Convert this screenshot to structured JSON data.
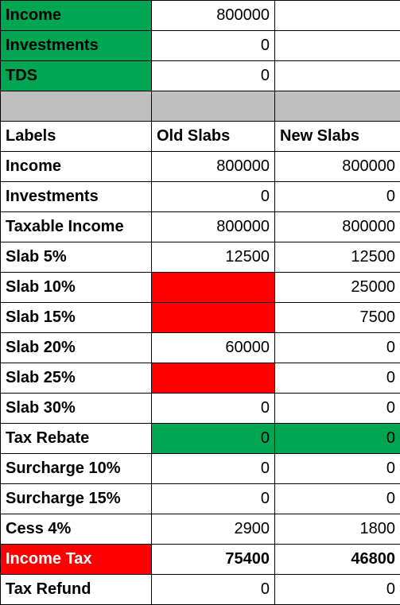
{
  "inputs": {
    "income_label": "Income",
    "income_value": "800000",
    "investments_label": "Investments",
    "investments_value": "0",
    "tds_label": "TDS",
    "tds_value": "0"
  },
  "headers": {
    "labels": "Labels",
    "old": "Old Slabs",
    "new": "New Slabs"
  },
  "rows": [
    {
      "label": "Income",
      "old": "800000",
      "new": "800000"
    },
    {
      "label": "Investments",
      "old": "0",
      "new": "0"
    },
    {
      "label": "Taxable Income",
      "old": "800000",
      "new": "800000"
    },
    {
      "label": "Slab 5%",
      "old": "12500",
      "new": "12500"
    },
    {
      "label": "Slab 10%",
      "old": "",
      "new": "25000"
    },
    {
      "label": "Slab 15%",
      "old": "",
      "new": "7500"
    },
    {
      "label": "Slab 20%",
      "old": "60000",
      "new": "0"
    },
    {
      "label": "Slab 25%",
      "old": "",
      "new": "0"
    },
    {
      "label": "Slab 30%",
      "old": "0",
      "new": "0"
    },
    {
      "label": "Tax Rebate",
      "old": "0",
      "new": "0"
    },
    {
      "label": "Surcharge 10%",
      "old": "0",
      "new": "0"
    },
    {
      "label": "Surcharge 15%",
      "old": "0",
      "new": "0"
    },
    {
      "label": "Cess 4%",
      "old": "2900",
      "new": "1800"
    },
    {
      "label": "Income Tax",
      "old": "75400",
      "new": "46800"
    },
    {
      "label": "Tax Refund",
      "old": "0",
      "new": "0"
    }
  ]
}
